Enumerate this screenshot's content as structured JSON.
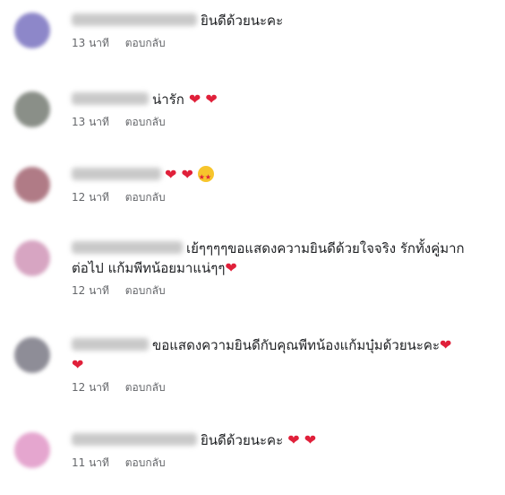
{
  "comments": [
    {
      "avatar_color": "#8d87c9",
      "name_width": 140,
      "text": "ยินดีด้วยนะคะ",
      "text_line2": "",
      "emoji": "",
      "time": "13 นาที",
      "reply": "ตอบกลับ"
    },
    {
      "avatar_color": "#8a8f88",
      "name_width": 86,
      "text": "น่ารัก",
      "text_line2": "",
      "emoji": "❤ ❤",
      "time": "13 นาที",
      "reply": "ตอบกลับ"
    },
    {
      "avatar_color": "#b07b86",
      "name_width": 100,
      "text": "",
      "text_line2": "",
      "emoji": "❤ ❤",
      "time": "12 นาที",
      "reply": "ตอบกลับ"
    },
    {
      "avatar_color": "#d7a5c2",
      "name_width": 124,
      "text": "เย้ๆๆๆๆขอแสดงความยินดีด้วยใจจริง รักทั้งคู่มาก",
      "text_line2": "ต่อไป แก้มพีทน้อยมาแน่ๆๆ",
      "emoji": "❤",
      "time": "12 นาที",
      "reply": "ตอบกลับ"
    },
    {
      "avatar_color": "#8e8d97",
      "name_width": 86,
      "text": "ขอแสดงความยินดีกับคุณพีทน้องแก้มบุ๋มด้วยนะคะ",
      "text_line2": "",
      "emoji": "❤",
      "time": "12 นาที",
      "reply": "ตอบกลับ"
    },
    {
      "avatar_color": "#e5a6cf",
      "name_width": 140,
      "text": "ยินดีด้วยนะคะ",
      "text_line2": "",
      "emoji": "❤ ❤",
      "time": "11 นาที",
      "reply": "ตอบกลับ"
    }
  ]
}
